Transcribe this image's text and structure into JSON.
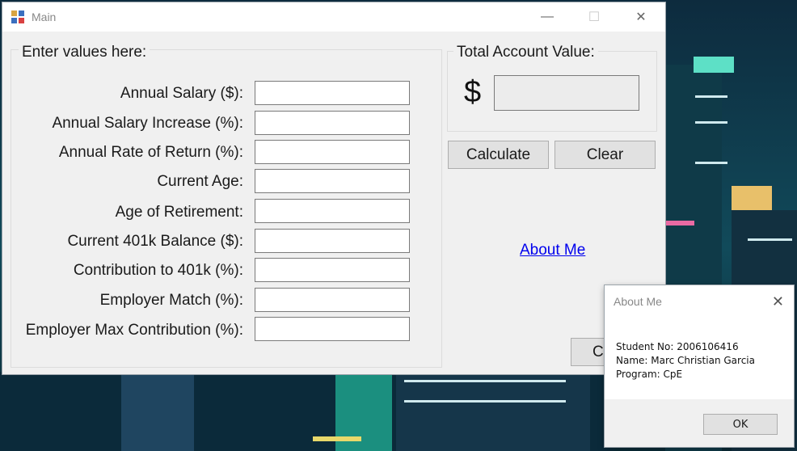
{
  "main_window": {
    "title": "Main",
    "controls": {
      "minimize": "—",
      "maximize": "☐",
      "close": "✕"
    }
  },
  "inputs_group": {
    "label": "Enter values here:",
    "fields": [
      {
        "label": "Annual Salary ($):",
        "value": ""
      },
      {
        "label": "Annual Salary Increase (%):",
        "value": ""
      },
      {
        "label": "Annual Rate of Return (%):",
        "value": ""
      },
      {
        "label": "Current Age:",
        "value": ""
      },
      {
        "label": "Age of Retirement:",
        "value": ""
      },
      {
        "label": "Current 401k Balance ($):",
        "value": ""
      },
      {
        "label": "Contribution to 401k (%):",
        "value": ""
      },
      {
        "label": "Employer Match (%):",
        "value": ""
      },
      {
        "label": "Employer Max Contribution (%):",
        "value": ""
      }
    ]
  },
  "total_group": {
    "label": "Total Account Value:",
    "currency_symbol": "$",
    "value": ""
  },
  "buttons": {
    "calculate": "Calculate",
    "clear": "Clear",
    "close_partial": "Cl"
  },
  "about_link": "About Me",
  "about_dialog": {
    "title": "About Me",
    "close": "✕",
    "lines": [
      "Student No: 2006106416",
      "Name: Marc Christian Garcia",
      "Program: CpE"
    ],
    "ok_label": "OK"
  }
}
